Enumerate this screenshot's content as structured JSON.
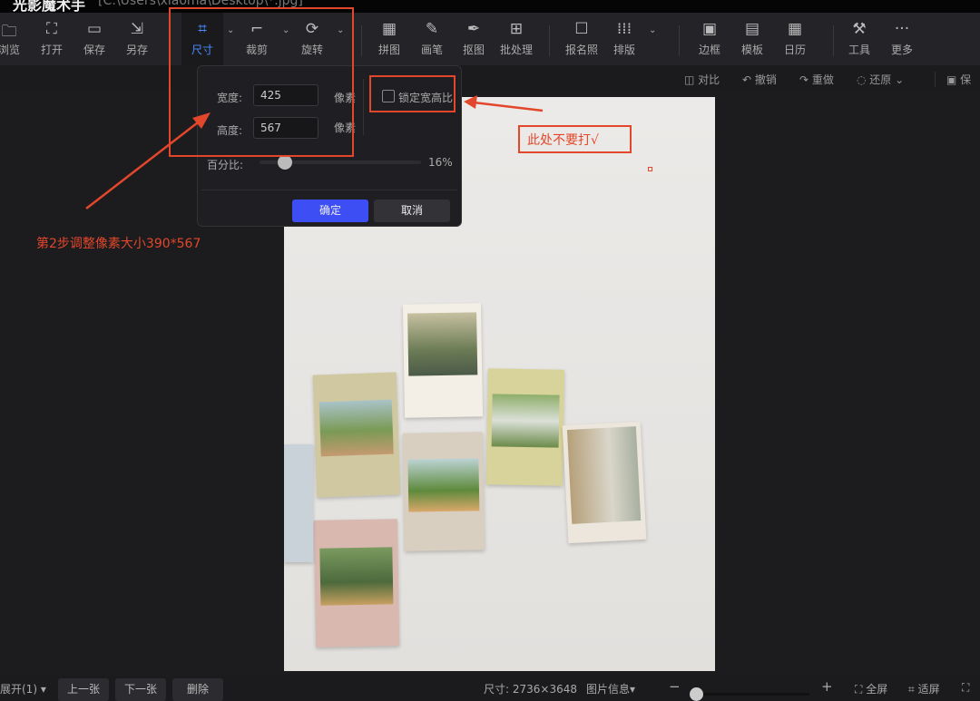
{
  "window": {
    "app_title": "光影魔术手",
    "file_path": "[C:\\Users\\xiaoma\\Desktop\\*.jpg]"
  },
  "toolbar": {
    "items": [
      {
        "id": "browse",
        "label": "浏览",
        "icon": "folder-icon"
      },
      {
        "id": "open",
        "label": "打开",
        "icon": "image-add-icon"
      },
      {
        "id": "save",
        "label": "保存",
        "icon": "save-icon"
      },
      {
        "id": "save-as",
        "label": "另存",
        "icon": "save-as-icon"
      },
      {
        "id": "size",
        "label": "尺寸",
        "icon": "resize-icon",
        "active": true
      },
      {
        "id": "crop",
        "label": "裁剪",
        "icon": "crop-icon"
      },
      {
        "id": "rotate",
        "label": "旋转",
        "icon": "rotate-icon"
      },
      {
        "id": "collage",
        "label": "拼图",
        "icon": "grid-icon"
      },
      {
        "id": "brush",
        "label": "画笔",
        "icon": "brush-icon"
      },
      {
        "id": "cutout",
        "label": "抠图",
        "icon": "pen-icon"
      },
      {
        "id": "batch",
        "label": "批处理",
        "icon": "batch-icon"
      },
      {
        "id": "id-photo",
        "label": "报名照",
        "icon": "portrait-icon"
      },
      {
        "id": "layout",
        "label": "排版",
        "icon": "layout-icon"
      },
      {
        "id": "border",
        "label": "边框",
        "icon": "frame-icon"
      },
      {
        "id": "template",
        "label": "模板",
        "icon": "template-icon"
      },
      {
        "id": "calendar",
        "label": "日历",
        "icon": "calendar-icon"
      },
      {
        "id": "tools",
        "label": "工具",
        "icon": "wrench-icon"
      },
      {
        "id": "more",
        "label": "更多",
        "icon": "more-icon"
      }
    ],
    "accent": "#4a8bff"
  },
  "subbar": {
    "compare": "对比",
    "undo": "撤销",
    "redo": "重做",
    "restore": "还原",
    "save": "保"
  },
  "dialog": {
    "width_label": "宽度:",
    "width_value": "425",
    "height_label": "高度:",
    "height_value": "567",
    "unit": "像素",
    "lock_label": "锁定宽高比",
    "lock_checked": false,
    "percent_label": "百分比:",
    "percent_value": "16%",
    "percent": 16,
    "ok": "确定",
    "cancel": "取消",
    "ok_color": "#3d4ef5"
  },
  "annotations": {
    "step2": "第2步调整像素大小390*567",
    "no_check": "此处不要打√",
    "color": "#e2472b"
  },
  "bottombar": {
    "expand": "展开(1)",
    "prev": "上一张",
    "next": "下一张",
    "delete": "删除",
    "size": "尺寸: 2736×3648",
    "info": "图片信息▾",
    "zoom_minus": "−",
    "zoom_plus": "+",
    "fullscreen": "全屏",
    "fit": "适屏"
  }
}
